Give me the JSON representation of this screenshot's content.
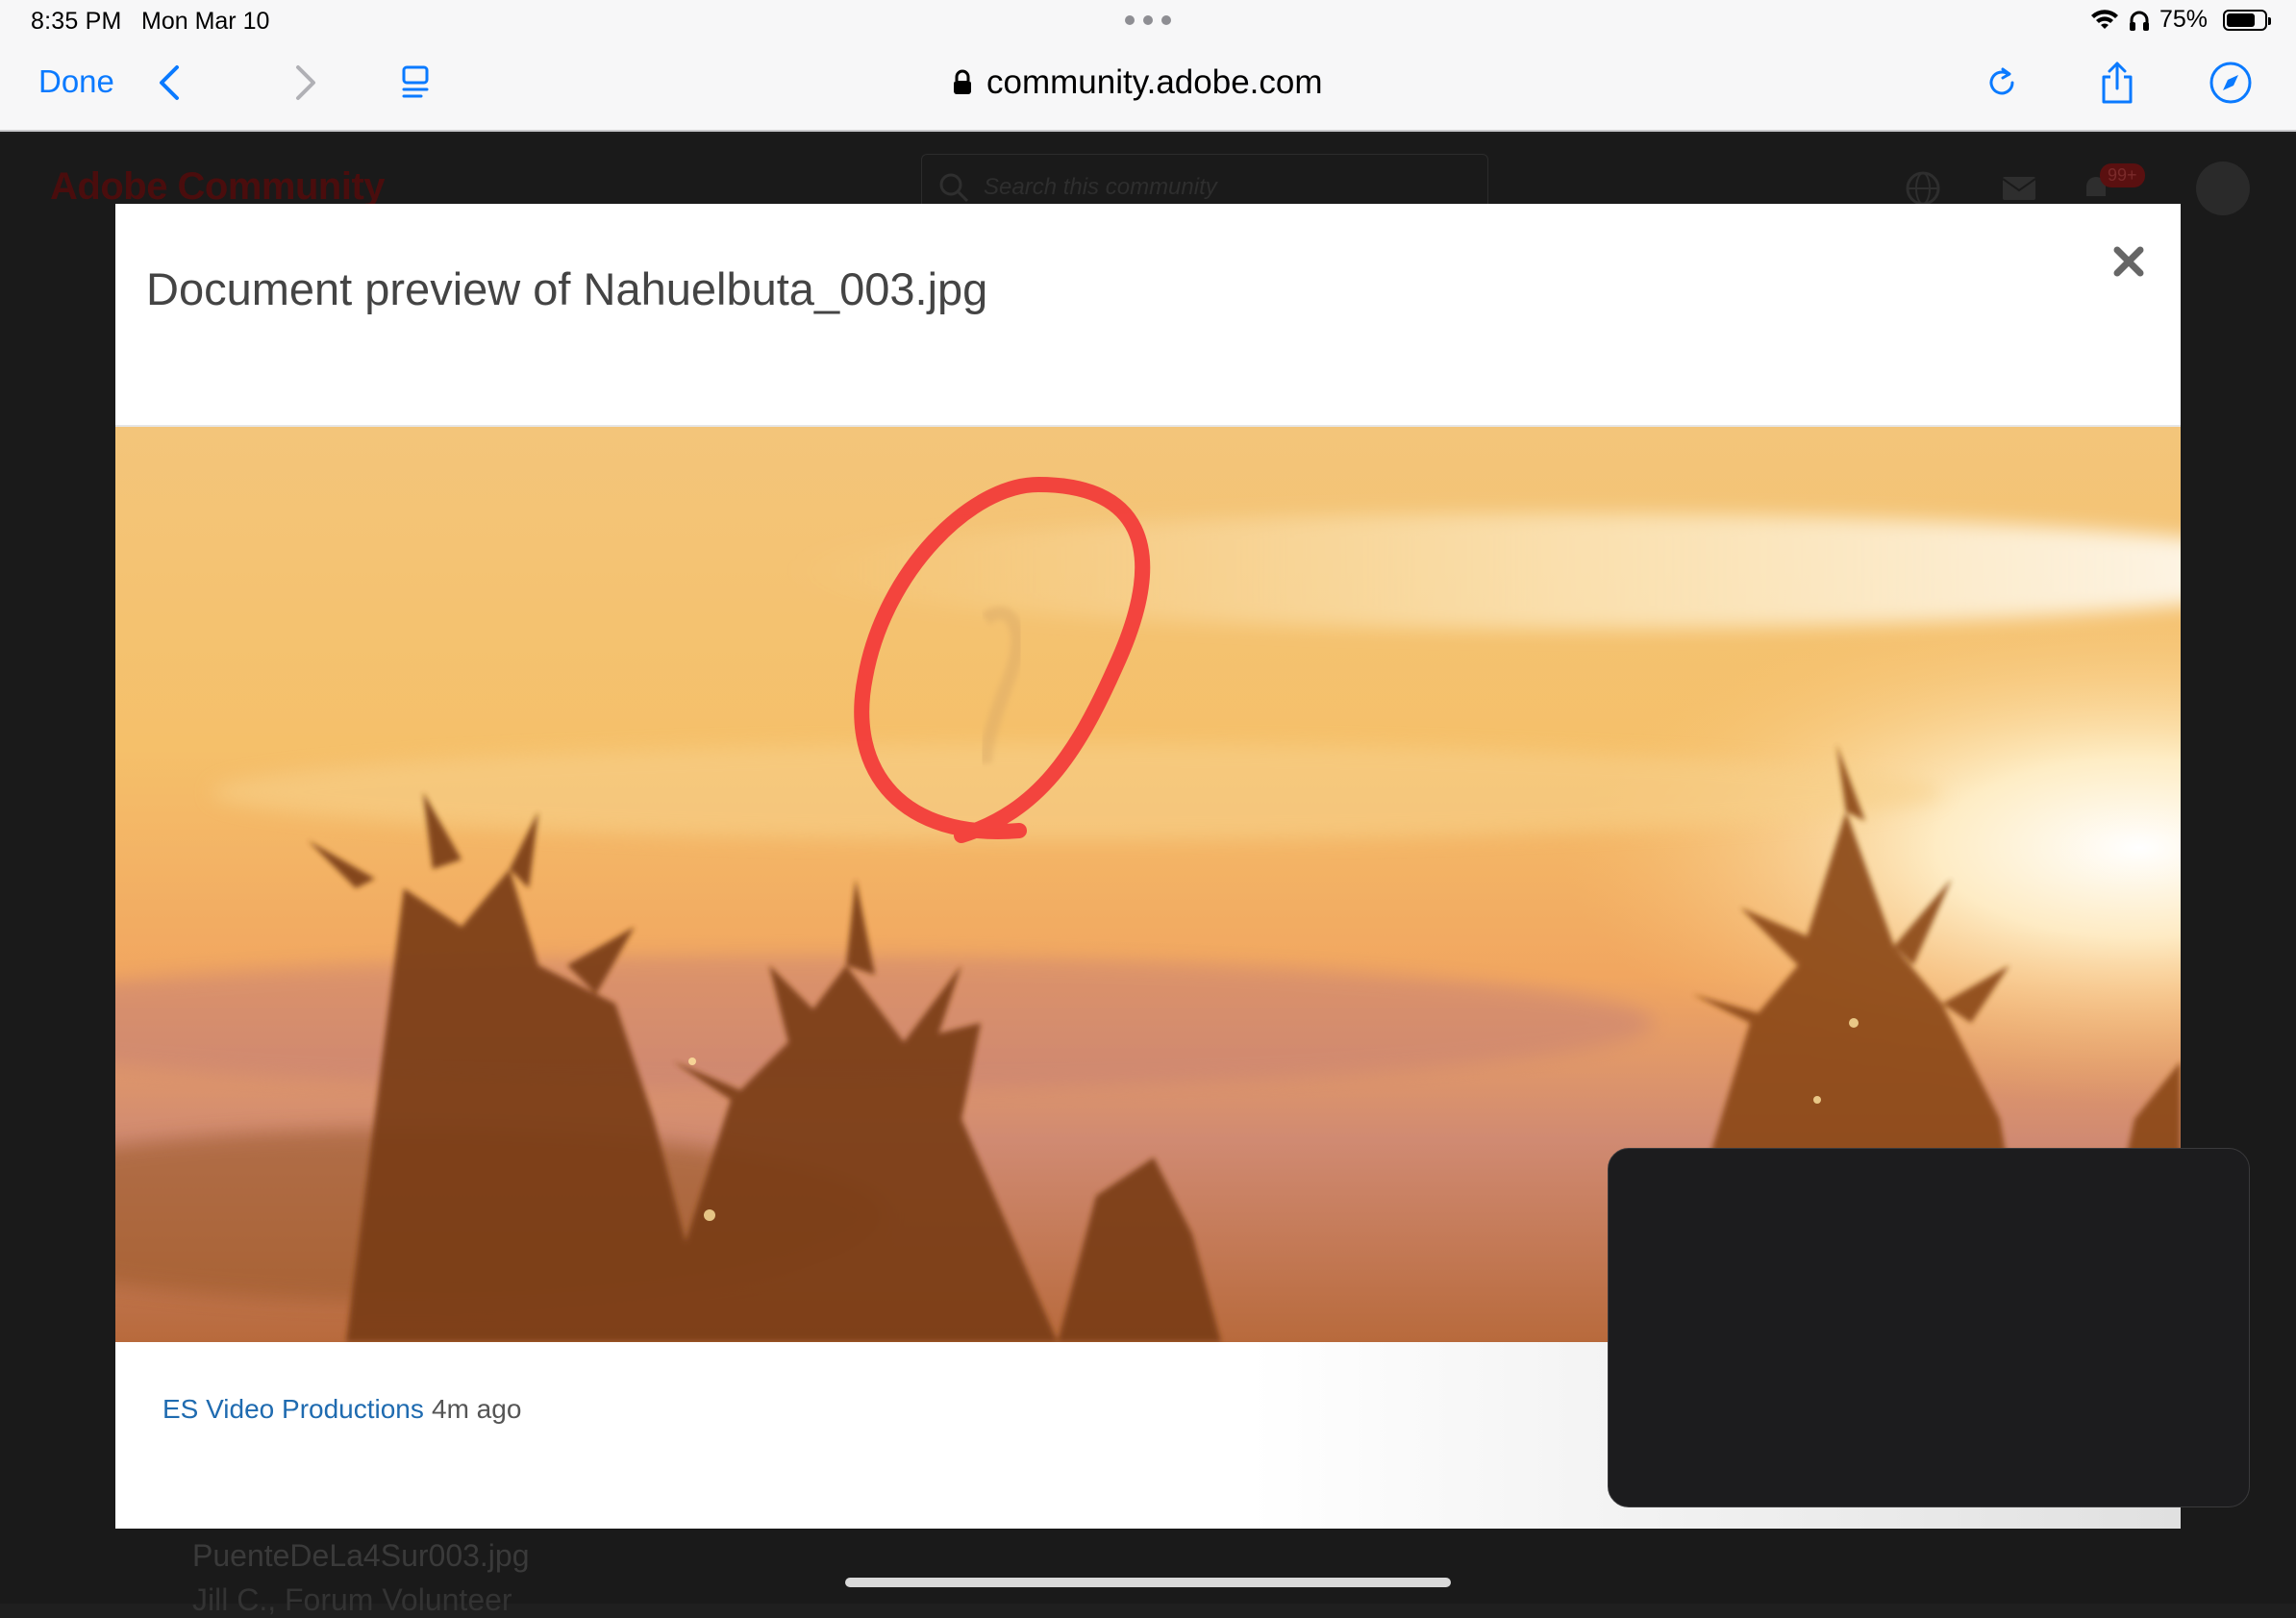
{
  "status_bar": {
    "time": "8:35 PM",
    "date": "Mon Mar 10",
    "battery_percent": "75%",
    "battery_level": 0.75
  },
  "safari_toolbar": {
    "done_label": "Done",
    "url": "community.adobe.com"
  },
  "background_page": {
    "brand": "Adobe Community",
    "search_placeholder": "Search this community",
    "notification_badge": "99+",
    "file_name": "PuenteDeLa4Sur003.jpg",
    "user_line": "Jill C., Forum Volunteer"
  },
  "modal": {
    "title": "Document preview of Nahuelbuta_003.jpg",
    "author": "ES Video Productions",
    "time_ago": "4m ago"
  },
  "colors": {
    "link_blue": "#0a7aff",
    "author_blue": "#1f6bb0",
    "annotation_red": "#f23838"
  }
}
